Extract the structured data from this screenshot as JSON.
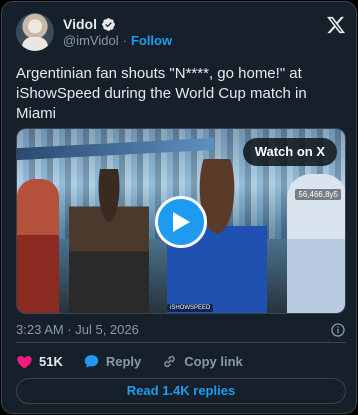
{
  "author": {
    "name": "Vidol",
    "handle": "@imVidol",
    "separator": "·",
    "follow_label": "Follow"
  },
  "tweet": {
    "text": "Argentinian fan shouts \"N****, go home!\" at iShowSpeed during the World Cup match in Miami"
  },
  "media": {
    "watch_label": "Watch on X",
    "counter_text": "56,466,8y5",
    "watermark_text": "iSHOWSPEED",
    "play_icon": "play-icon"
  },
  "meta": {
    "timestamp": "3:23 AM · Jul 5, 2026"
  },
  "actions": {
    "likes": "51K",
    "reply_label": "Reply",
    "copy_label": "Copy link"
  },
  "read_replies_label": "Read 1.4K replies",
  "colors": {
    "background": "#15202b",
    "accent": "#1d9bf0",
    "like": "#f91880",
    "muted": "#8b98a5",
    "text": "#e7e9ea",
    "border": "#38444d"
  }
}
